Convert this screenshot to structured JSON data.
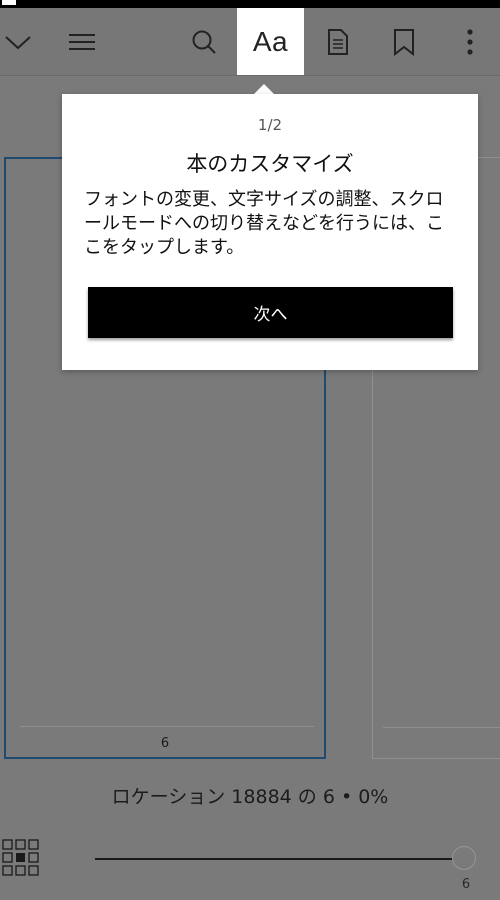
{
  "toolbar": {
    "font_button_label": "Aa",
    "icons": [
      "chevron-down-icon",
      "menu-icon",
      "search-icon",
      "font-settings",
      "notebook-icon",
      "bookmark-icon",
      "more-vert-icon"
    ]
  },
  "reader": {
    "left_page_number": "6",
    "location_text": "ロケーション 18884 の 6 • 0%",
    "slider_value": "6",
    "progress_fraction": 1.0
  },
  "tooltip": {
    "step": "1/2",
    "title": "本のカスタマイズ",
    "body": "フォントの変更、文字サイズの調整、スクロールモードへの切り替えなどを行うには、ここをタップします。",
    "next_label": "次へ"
  }
}
